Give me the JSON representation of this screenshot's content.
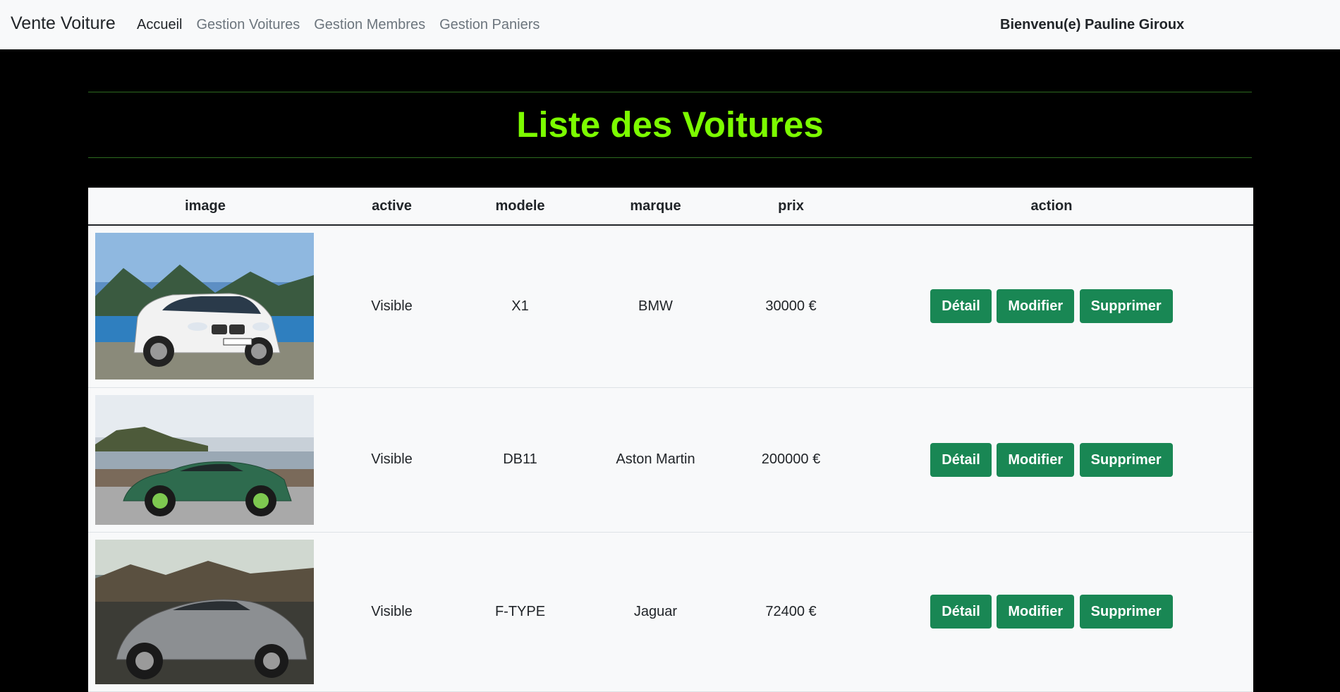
{
  "navbar": {
    "brand": "Vente Voiture",
    "links": [
      {
        "label": "Accueil",
        "active": true
      },
      {
        "label": "Gestion Voitures",
        "active": false
      },
      {
        "label": "Gestion Membres",
        "active": false
      },
      {
        "label": "Gestion Paniers",
        "active": false
      }
    ],
    "welcome": "Bienvenu(e) Pauline Giroux"
  },
  "page": {
    "title": "Liste des Voitures"
  },
  "table": {
    "headers": [
      "image",
      "active",
      "modele",
      "marque",
      "prix",
      "action"
    ],
    "rows": [
      {
        "image": "BMW X1 white SUV photo",
        "active": "Visible",
        "modele": "X1",
        "marque": "BMW",
        "prix": "30000 €"
      },
      {
        "image": "Aston Martin DB11 green coupe photo",
        "active": "Visible",
        "modele": "DB11",
        "marque": "Aston Martin",
        "prix": "200000 €"
      },
      {
        "image": "Jaguar F-TYPE grey coupe photo",
        "active": "Visible",
        "modele": "F-TYPE",
        "marque": "Jaguar",
        "prix": "72400 €"
      }
    ],
    "actions": {
      "detail": "Détail",
      "modifier": "Modifier",
      "supprimer": "Supprimer"
    }
  },
  "colors": {
    "title": "#7cfc00",
    "button": "#198754",
    "navbar_bg": "#f8f9fa",
    "page_bg": "#000000"
  }
}
